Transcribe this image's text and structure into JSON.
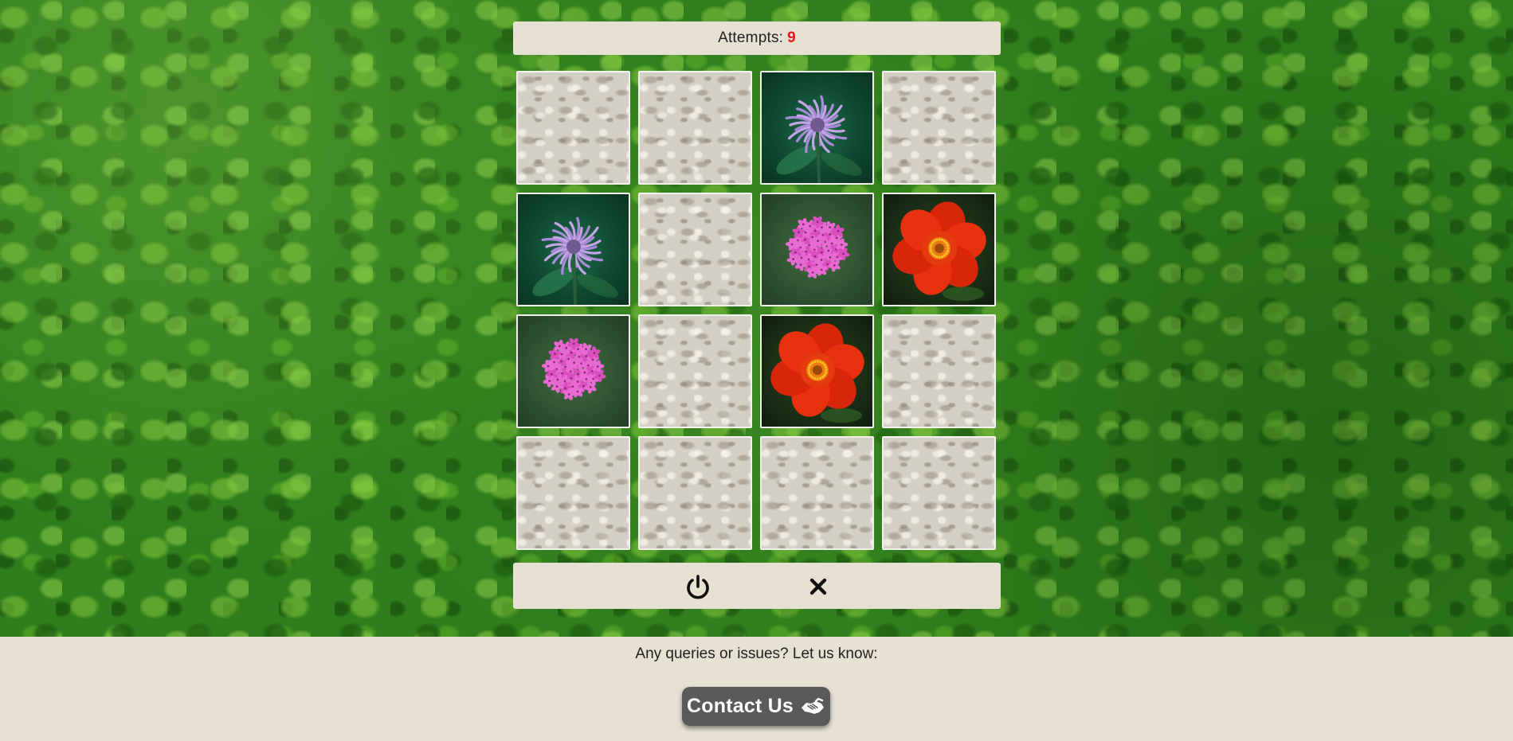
{
  "attempts": {
    "label": "Attempts:",
    "count": "9",
    "count_color": "#e8161a"
  },
  "board": {
    "columns": 4,
    "rows": 4,
    "cards": [
      {
        "state": "face-down",
        "image": ""
      },
      {
        "state": "face-down",
        "image": ""
      },
      {
        "state": "face-up",
        "image": "purple-bee-balm-flower"
      },
      {
        "state": "face-down",
        "image": ""
      },
      {
        "state": "face-up",
        "image": "purple-bee-balm-flower"
      },
      {
        "state": "face-down",
        "image": ""
      },
      {
        "state": "face-up",
        "image": "pink-verbena-flower"
      },
      {
        "state": "face-up",
        "image": "red-poppy-flower"
      },
      {
        "state": "face-up",
        "image": "pink-verbena-flower"
      },
      {
        "state": "face-down",
        "image": ""
      },
      {
        "state": "face-up",
        "image": "red-poppy-flower"
      },
      {
        "state": "face-down",
        "image": ""
      },
      {
        "state": "face-down",
        "image": ""
      },
      {
        "state": "face-down",
        "image": ""
      },
      {
        "state": "face-down",
        "image": ""
      },
      {
        "state": "face-down",
        "image": ""
      }
    ]
  },
  "controls": {
    "restart_icon": "power-icon",
    "quit_icon": "close-icon"
  },
  "footer": {
    "text": "Any queries or issues? Let us know:",
    "contact_label": "Contact Us",
    "contact_icon": "handshake-icon"
  },
  "colors": {
    "panel_bg": "#e6e1d3",
    "contact_bg": "#5b5a5a",
    "background": "ivy-green"
  }
}
